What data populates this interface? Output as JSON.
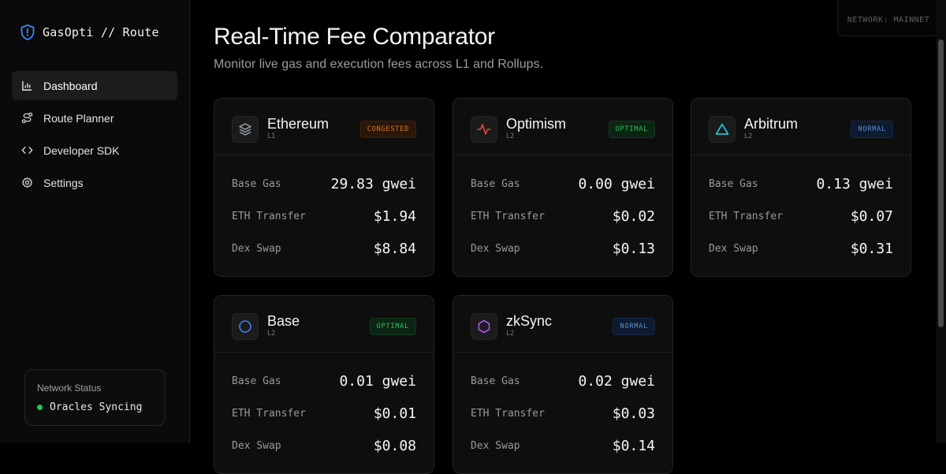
{
  "app": {
    "brand": "GasOpti // Route",
    "network": "NETWORK: MAINNET"
  },
  "sidebar": {
    "items": [
      {
        "label": "Dashboard",
        "icon": "bar-chart-icon",
        "active": true
      },
      {
        "label": "Route Planner",
        "icon": "route-icon",
        "active": false
      },
      {
        "label": "Developer SDK",
        "icon": "code-icon",
        "active": false
      },
      {
        "label": "Settings",
        "icon": "gear-icon",
        "active": false
      }
    ],
    "status": {
      "title": "Network Status",
      "text": "Oracles Syncing",
      "color": "#22c55e"
    }
  },
  "header": {
    "title": "Real-Time Fee Comparator",
    "subtitle": "Monitor live gas and execution fees across L1 and Rollups."
  },
  "cards": [
    {
      "name": "Ethereum",
      "layer": "L1",
      "badge": "CONGESTED",
      "status": "congested",
      "icon": "layers-icon",
      "rows": [
        {
          "label": "Base Gas",
          "value": "29.83 gwei"
        },
        {
          "label": "ETH Transfer",
          "value": "$1.94"
        },
        {
          "label": "Dex Swap",
          "value": "$8.84"
        }
      ]
    },
    {
      "name": "Optimism",
      "layer": "L2",
      "badge": "OPTIMAL",
      "status": "optimal",
      "icon": "activity-icon",
      "rows": [
        {
          "label": "Base Gas",
          "value": "0.00 gwei"
        },
        {
          "label": "ETH Transfer",
          "value": "$0.02"
        },
        {
          "label": "Dex Swap",
          "value": "$0.13"
        }
      ]
    },
    {
      "name": "Arbitrum",
      "layer": "L2",
      "badge": "NORMAL",
      "status": "normal",
      "icon": "triangle-icon",
      "rows": [
        {
          "label": "Base Gas",
          "value": "0.13 gwei"
        },
        {
          "label": "ETH Transfer",
          "value": "$0.07"
        },
        {
          "label": "Dex Swap",
          "value": "$0.31"
        }
      ]
    },
    {
      "name": "Base",
      "layer": "L2",
      "badge": "OPTIMAL",
      "status": "optimal",
      "icon": "circle-icon",
      "rows": [
        {
          "label": "Base Gas",
          "value": "0.01 gwei"
        },
        {
          "label": "ETH Transfer",
          "value": "$0.01"
        },
        {
          "label": "Dex Swap",
          "value": "$0.08"
        }
      ]
    },
    {
      "name": "zkSync",
      "layer": "L2",
      "badge": "NORMAL",
      "status": "normal",
      "icon": "hexagon-icon",
      "rows": [
        {
          "label": "Base Gas",
          "value": "0.02 gwei"
        },
        {
          "label": "ETH Transfer",
          "value": "$0.03"
        },
        {
          "label": "Dex Swap",
          "value": "$0.14"
        }
      ]
    }
  ],
  "colors": {
    "ethereum": "#9ca3af",
    "optimism": "#ef4444",
    "arbitrum": "#22d3ee",
    "base": "#3b82f6",
    "zksync": "#a855f7"
  }
}
